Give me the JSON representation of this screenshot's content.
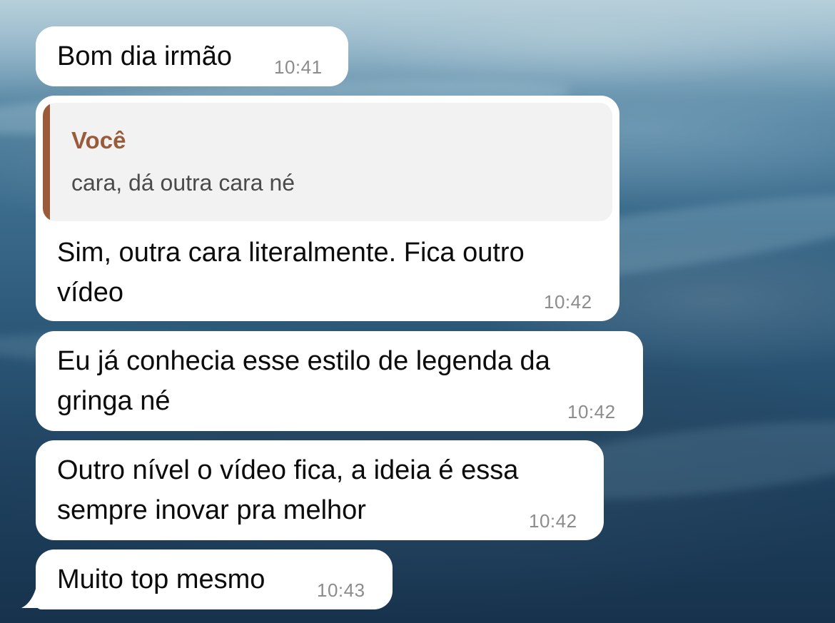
{
  "background": {
    "theme": "ocean-waves"
  },
  "colors": {
    "bubble": "#ffffff",
    "quote_accent": "#9a5b3a",
    "quote_background": "#f2f2f2",
    "timestamp": "#8c8c8c"
  },
  "messages": [
    {
      "text": "Bom dia irmão",
      "time": "10:41"
    },
    {
      "reply_to": {
        "author": "Você",
        "text": "cara, dá outra cara né"
      },
      "lines": [
        "Sim, outra cara literalmente. Fica outro",
        "vídeo"
      ],
      "time": "10:42"
    },
    {
      "lines": [
        "Eu já conhecia esse estilo de legenda da",
        "gringa né"
      ],
      "time": "10:42"
    },
    {
      "lines": [
        "Outro nível o vídeo fica, a ideia é essa",
        "sempre inovar pra melhor"
      ],
      "time": "10:42"
    },
    {
      "text": "Muito top mesmo",
      "time": "10:43"
    }
  ]
}
